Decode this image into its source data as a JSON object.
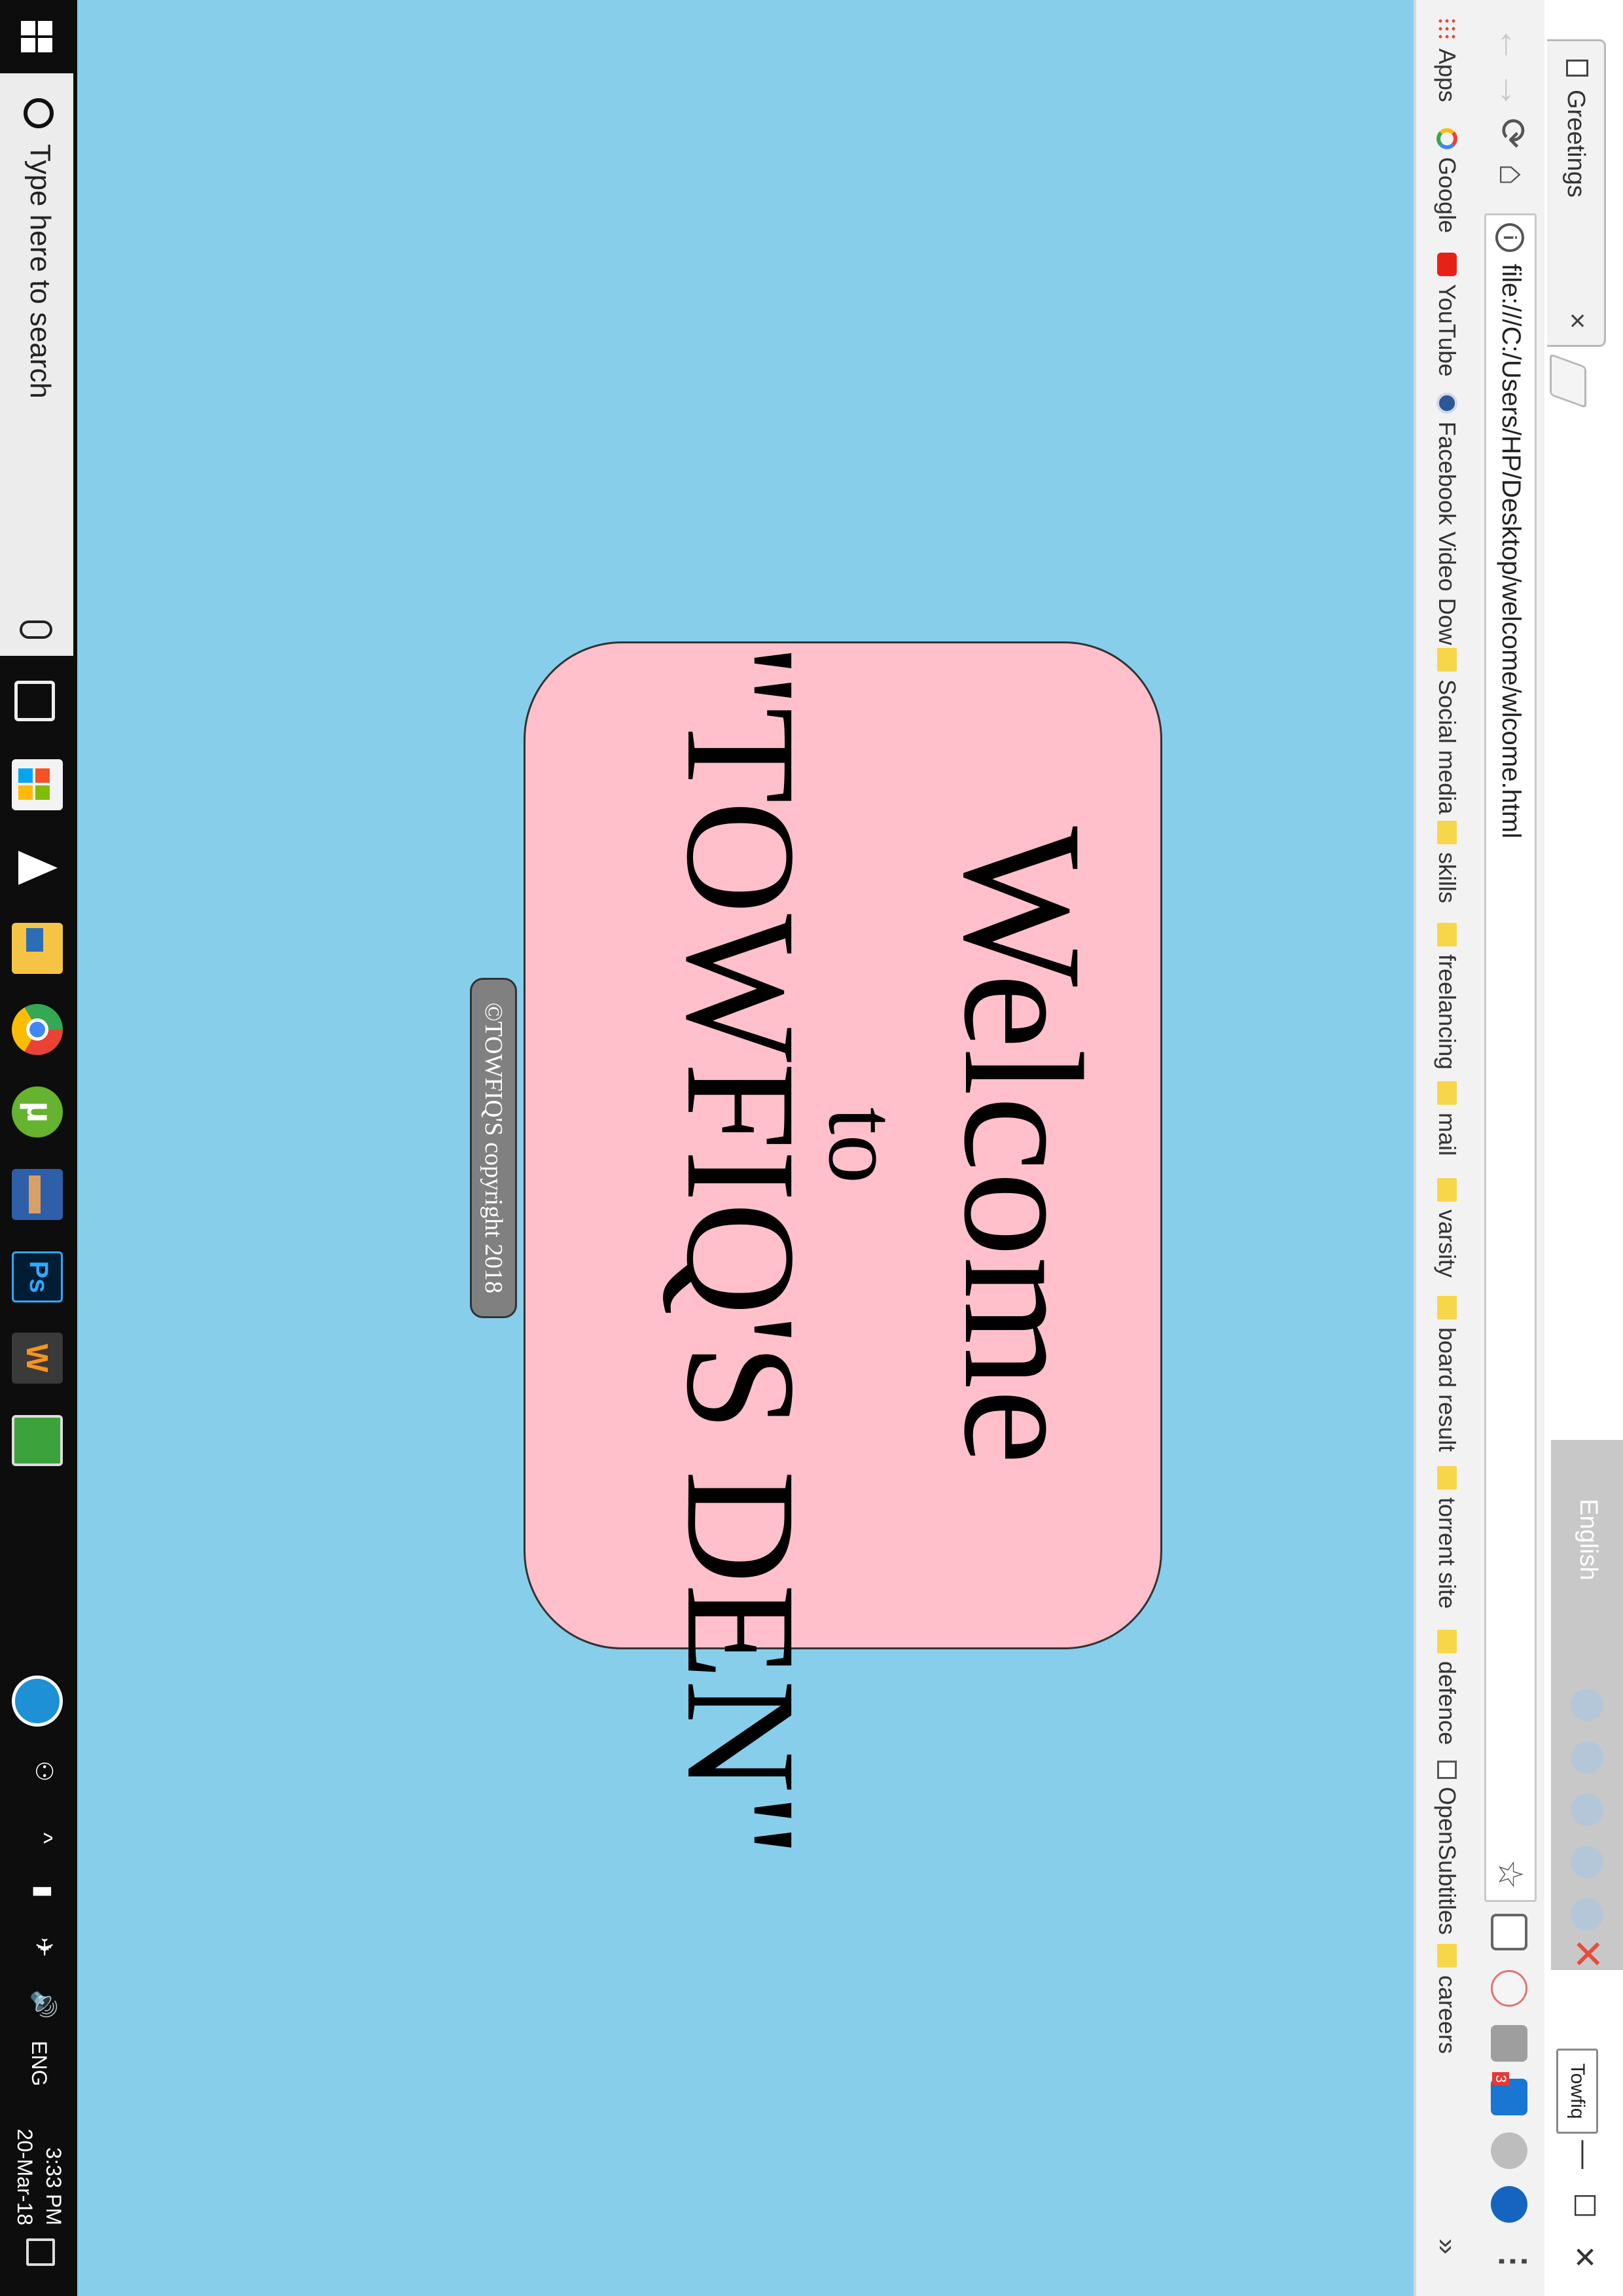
{
  "browser": {
    "tab": {
      "title": "Greetings",
      "close": "×"
    },
    "ime": {
      "language": "English"
    },
    "profile": {
      "name": "Towfiq"
    },
    "window_controls": {
      "minimize": "—",
      "maximize": "☐",
      "close": "✕"
    },
    "nav": {
      "back": "←",
      "forward": "→",
      "reload": "⟳",
      "home": "⌂"
    },
    "omnibox": {
      "url": "file:///C:/Users/HP/Desktop/welcome/wlcome.html",
      "info_icon": "i",
      "star": "☆"
    },
    "extensions": [
      {
        "name": "page-ext-icon"
      },
      {
        "name": "adblock-ext-icon"
      },
      {
        "name": "grey-ext-icon"
      },
      {
        "name": "blue-ext-icon",
        "badge": "3"
      },
      {
        "name": "globe-ext-icon"
      },
      {
        "name": "fb-downloader-ext-icon"
      }
    ],
    "menu": "⋮",
    "bookmarks": [
      {
        "label": "Apps",
        "icon": "apps"
      },
      {
        "label": "Google",
        "icon": "google"
      },
      {
        "label": "YouTube",
        "icon": "youtube"
      },
      {
        "label": "Facebook Video Dow",
        "icon": "facebook"
      },
      {
        "label": "Social media",
        "icon": "folder"
      },
      {
        "label": "skills",
        "icon": "folder"
      },
      {
        "label": "freelancing",
        "icon": "folder"
      },
      {
        "label": "mail",
        "icon": "folder"
      },
      {
        "label": "varsity",
        "icon": "folder"
      },
      {
        "label": "board result",
        "icon": "folder"
      },
      {
        "label": "torrent site",
        "icon": "folder"
      },
      {
        "label": "defence",
        "icon": "folder"
      },
      {
        "label": "OpenSubtitles",
        "icon": "page"
      },
      {
        "label": "careers",
        "icon": "folder"
      }
    ],
    "bookmarks_more": "»"
  },
  "page": {
    "background": "#87ceeb",
    "box_color": "#ffc0cb",
    "welcome_line1": "Welcome",
    "welcome_line2": "to",
    "welcome_line3": "\"TOWFIQ'S DEN\"",
    "copyright": "©TOWFIQ'S copyright 2018"
  },
  "taskbar": {
    "search_placeholder": "Type here to search",
    "tray": {
      "people": "⚇",
      "chevron": "^",
      "battery": "▮",
      "network": "✈",
      "volume": "🔊",
      "language": "ENG"
    },
    "time": "3:33 PM",
    "date": "20-Mar-18"
  }
}
